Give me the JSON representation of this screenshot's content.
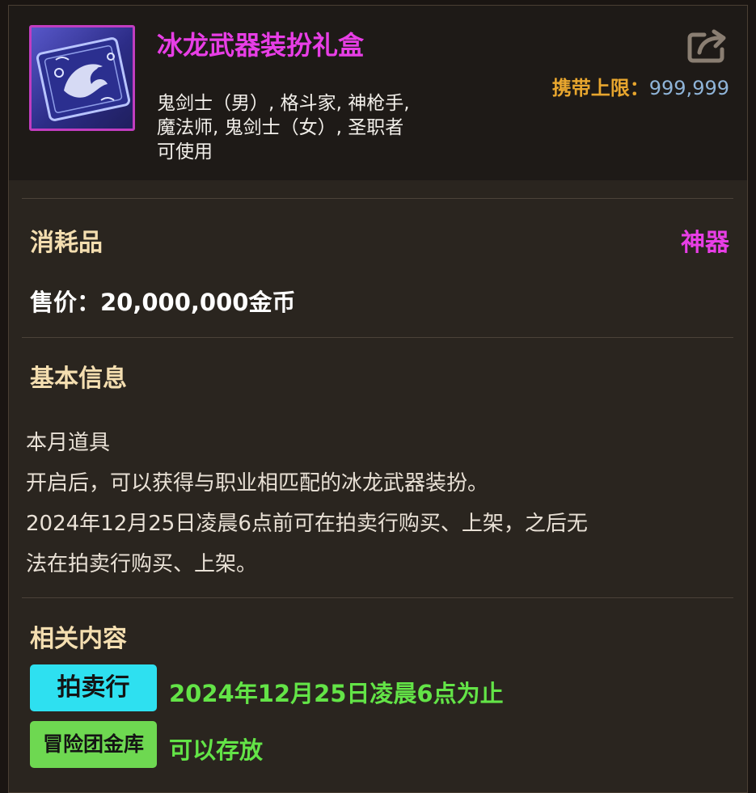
{
  "item": {
    "name": "冰龙武器装扮礼盒",
    "classes_line1": "鬼剑士（男）, 格斗家, 神枪手,",
    "classes_line2": "魔法师, 鬼剑士（女）, 圣职者",
    "classes_line3": "可使用",
    "icon": "dragon-gift-box-icon",
    "name_color": "#e83ee6"
  },
  "carry_limit": {
    "label": "携带上限：",
    "value": "999,999"
  },
  "type_label": "消耗品",
  "rarity": "神器",
  "price": "售价：20,000,000金币",
  "basic_info": {
    "title": "基本信息",
    "lines": [
      "本月道具",
      "开启后，可以获得与职业相匹配的冰龙武器装扮。",
      "2024年12月25日凌晨6点前可在拍卖行购买、上架，之后无",
      "法在拍卖行购买、上架。"
    ]
  },
  "related": {
    "title": "相关内容",
    "auction_tag": "拍卖行",
    "auction_text": "2024年12月25日凌晨6点为止",
    "bank_tag": "冒险团金库",
    "bank_text": "可以存放"
  },
  "share_icon": "share-icon"
}
